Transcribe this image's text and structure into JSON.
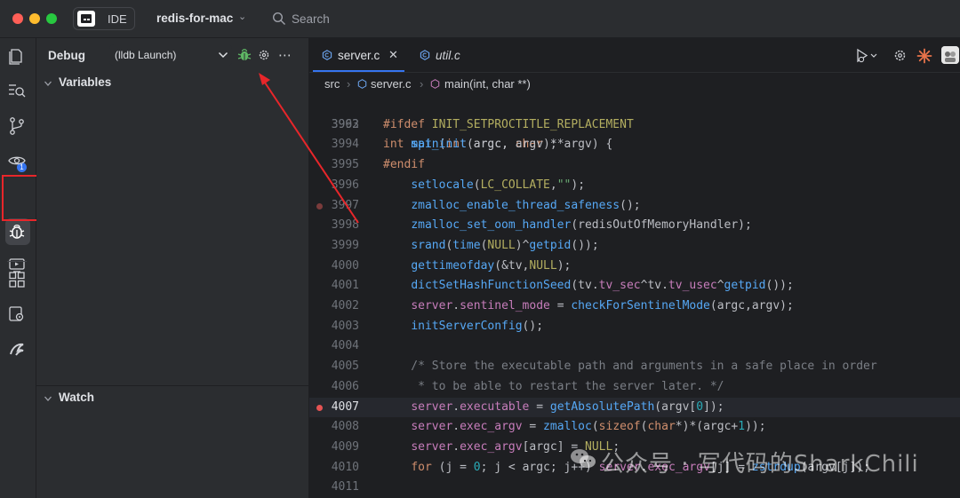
{
  "titlebar": {
    "ide_label": "IDE",
    "project": "redis-for-mac",
    "search_label": "Search"
  },
  "activity": {
    "commit_badge": "1",
    "icons": [
      "project-icon",
      "find-icon",
      "git-branch-icon",
      "eye-icon",
      "debug-icon",
      "services-icon",
      "plugins-icon",
      "settings-icon",
      "rust-icon"
    ]
  },
  "debug_panel": {
    "title": "Debug",
    "config": "(lldb Launch)",
    "variables_label": "Variables",
    "watch_label": "Watch"
  },
  "editor": {
    "tabs": [
      {
        "label": "server.c",
        "active": true
      },
      {
        "label": "util.c",
        "active": false
      }
    ],
    "breadcrumb": [
      "src",
      "server.c",
      "main(int, char **)"
    ],
    "sticky_header": {
      "number": "3962",
      "text": "int main(int argc, char **argv) {"
    },
    "lines": [
      {
        "number": "3993",
        "text": "#ifdef INIT_SETPROCTITLE_REPLACEMENT"
      },
      {
        "number": "3994",
        "text": "    spt_init(argc, argv);"
      },
      {
        "number": "3995",
        "text": "#endif"
      },
      {
        "number": "3996",
        "text": "    setlocale(LC_COLLATE,\"\");"
      },
      {
        "number": "3997",
        "text": "    zmalloc_enable_thread_safeness();",
        "breakpoint": "muted"
      },
      {
        "number": "3998",
        "text": "    zmalloc_set_oom_handler(redisOutOfMemoryHandler);"
      },
      {
        "number": "3999",
        "text": "    srand(time(NULL)^getpid());"
      },
      {
        "number": "4000",
        "text": "    gettimeofday(&tv,NULL);"
      },
      {
        "number": "4001",
        "text": "    dictSetHashFunctionSeed(tv.tv_sec^tv.tv_usec^getpid());"
      },
      {
        "number": "4002",
        "text": "    server.sentinel_mode = checkForSentinelMode(argc,argv);"
      },
      {
        "number": "4003",
        "text": "    initServerConfig();"
      },
      {
        "number": "4004",
        "text": ""
      },
      {
        "number": "4005",
        "text": "    /* Store the executable path and arguments in a safe place in order"
      },
      {
        "number": "4006",
        "text": "     * to be able to restart the server later. */"
      },
      {
        "number": "4007",
        "text": "    server.executable = getAbsolutePath(argv[0]);",
        "breakpoint": "active",
        "current": true
      },
      {
        "number": "4008",
        "text": "    server.exec_argv = zmalloc(sizeof(char*)*(argc+1));"
      },
      {
        "number": "4009",
        "text": "    server.exec_argv[argc] = NULL;"
      },
      {
        "number": "4010",
        "text": "    for (j = 0; j < argc; j++) server.exec_argv[j] = zstrdup(argv[j]);"
      },
      {
        "number": "4011",
        "text": ""
      }
    ]
  },
  "watermark": "公众号 · 写代码的SharkChili",
  "colors": {
    "accent": "#3574f0",
    "breakpoint": "#e55353",
    "annotation": "#e8262a",
    "bug_green": "#5fb865"
  }
}
